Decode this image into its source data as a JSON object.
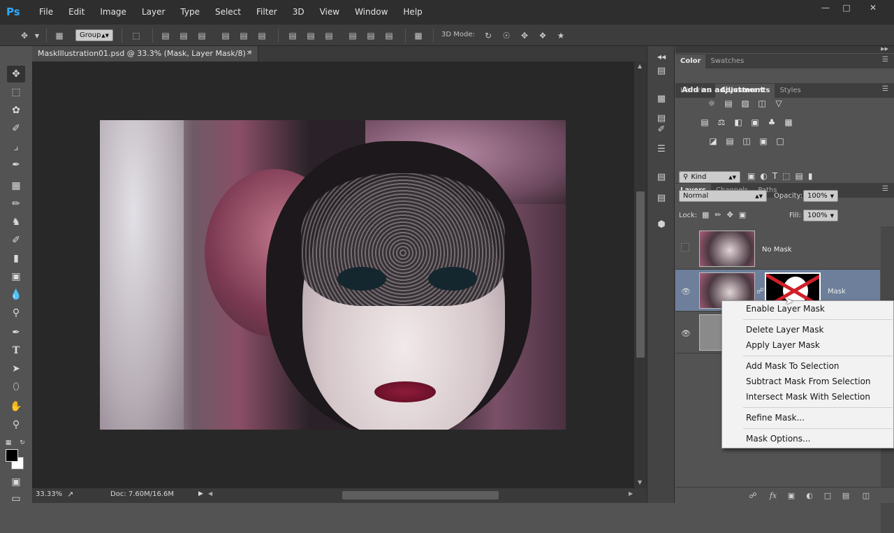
{
  "app": {
    "logo": "Ps"
  },
  "menubar": {
    "items": [
      "File",
      "Edit",
      "Image",
      "Layer",
      "Type",
      "Select",
      "Filter",
      "3D",
      "View",
      "Window",
      "Help"
    ]
  },
  "options": {
    "auto_select_value": "Group",
    "mode_3d_label": "3D Mode:"
  },
  "document": {
    "tab_title": "MaskIllustration01.psd @ 33.3% (Mask, Layer Mask/8) *",
    "zoom": "33.33%",
    "doc_info": "Doc: 7.60M/16.6M"
  },
  "panels": {
    "top_tabs": [
      "Color",
      "Swatches"
    ],
    "mid_tabs": [
      "Libraries",
      "Adjustments",
      "Styles"
    ],
    "adjust_heading": "Add an adjustment",
    "layers_tabs": [
      "Layers",
      "Channels",
      "Paths"
    ],
    "filter_kind": "Kind",
    "blend_mode": "Normal",
    "opacity_label": "Opacity:",
    "opacity_value": "100%",
    "lock_label": "Lock:",
    "fill_label": "Fill:",
    "fill_value": "100%"
  },
  "layers": [
    {
      "name": "No Mask",
      "visible": false
    },
    {
      "name": "Mask",
      "visible": true,
      "selected": true
    },
    {
      "name": "",
      "visible": true
    }
  ],
  "context_menu": {
    "items": [
      "Enable Layer Mask",
      "Delete Layer Mask",
      "Apply Layer Mask",
      "Add Mask To Selection",
      "Subtract Mask From Selection",
      "Intersect Mask With Selection",
      "Refine Mask...",
      "Mask Options..."
    ]
  },
  "colors": {
    "accent": "#31a8ff",
    "selected_layer": "#6d7f9a",
    "mask_cross": "#d0202a"
  }
}
